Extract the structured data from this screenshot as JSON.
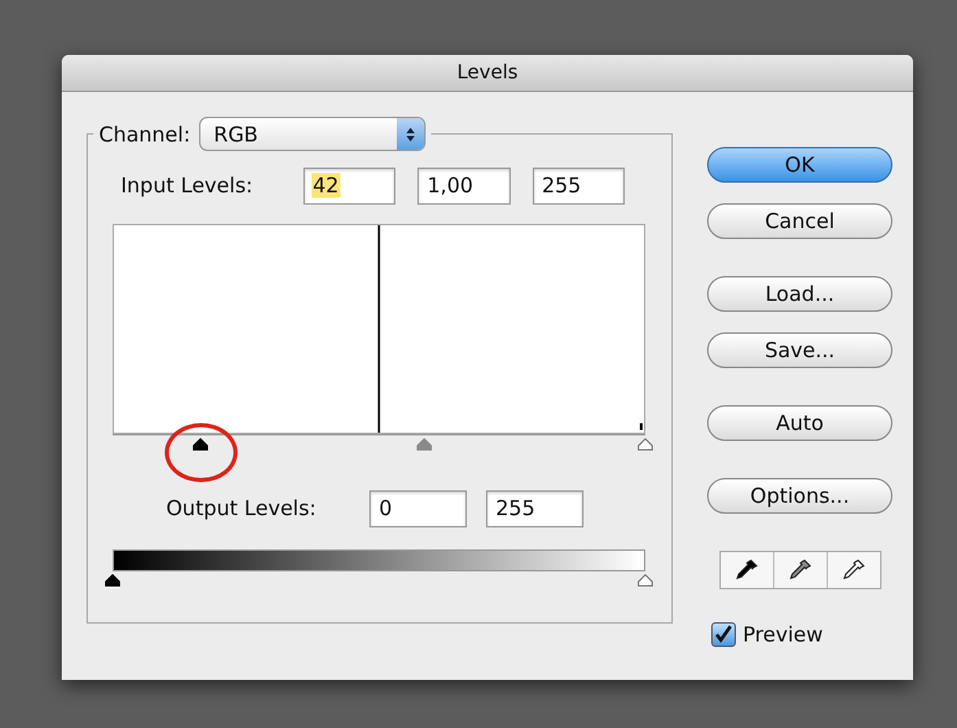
{
  "window": {
    "title": "Levels"
  },
  "channel": {
    "label": "Channel:",
    "value": "RGB"
  },
  "input_levels": {
    "label": "Input Levels:",
    "fields": [
      {
        "value": "42",
        "highlighted": true
      },
      {
        "value": "1,00",
        "highlighted": false
      },
      {
        "value": "255",
        "highlighted": false
      }
    ]
  },
  "input_sliders": [
    {
      "kind": "shadow",
      "level": 0.165,
      "circled": true
    },
    {
      "kind": "midtone",
      "level": 0.585
    },
    {
      "kind": "highlight",
      "level": 1
    }
  ],
  "output_levels": {
    "label": "Output Levels:",
    "fields": [
      {
        "value": "0"
      },
      {
        "value": "255"
      }
    ]
  },
  "output_sliders": [
    {
      "kind": "shadow",
      "level": 0
    },
    {
      "kind": "highlight",
      "level": 1
    }
  ],
  "buttons": [
    {
      "label": "OK",
      "default": true
    },
    {
      "label": "Cancel",
      "default": false
    },
    {
      "label": "Load...",
      "default": false
    },
    {
      "label": "Save...",
      "default": false
    },
    {
      "label": "Auto",
      "default": false
    },
    {
      "label": "Options...",
      "default": false
    }
  ],
  "eyedroppers": [
    {
      "kind": "shadow"
    },
    {
      "kind": "midtone"
    },
    {
      "kind": "highlight"
    }
  ],
  "preview": {
    "label": "Preview",
    "checked": true
  }
}
